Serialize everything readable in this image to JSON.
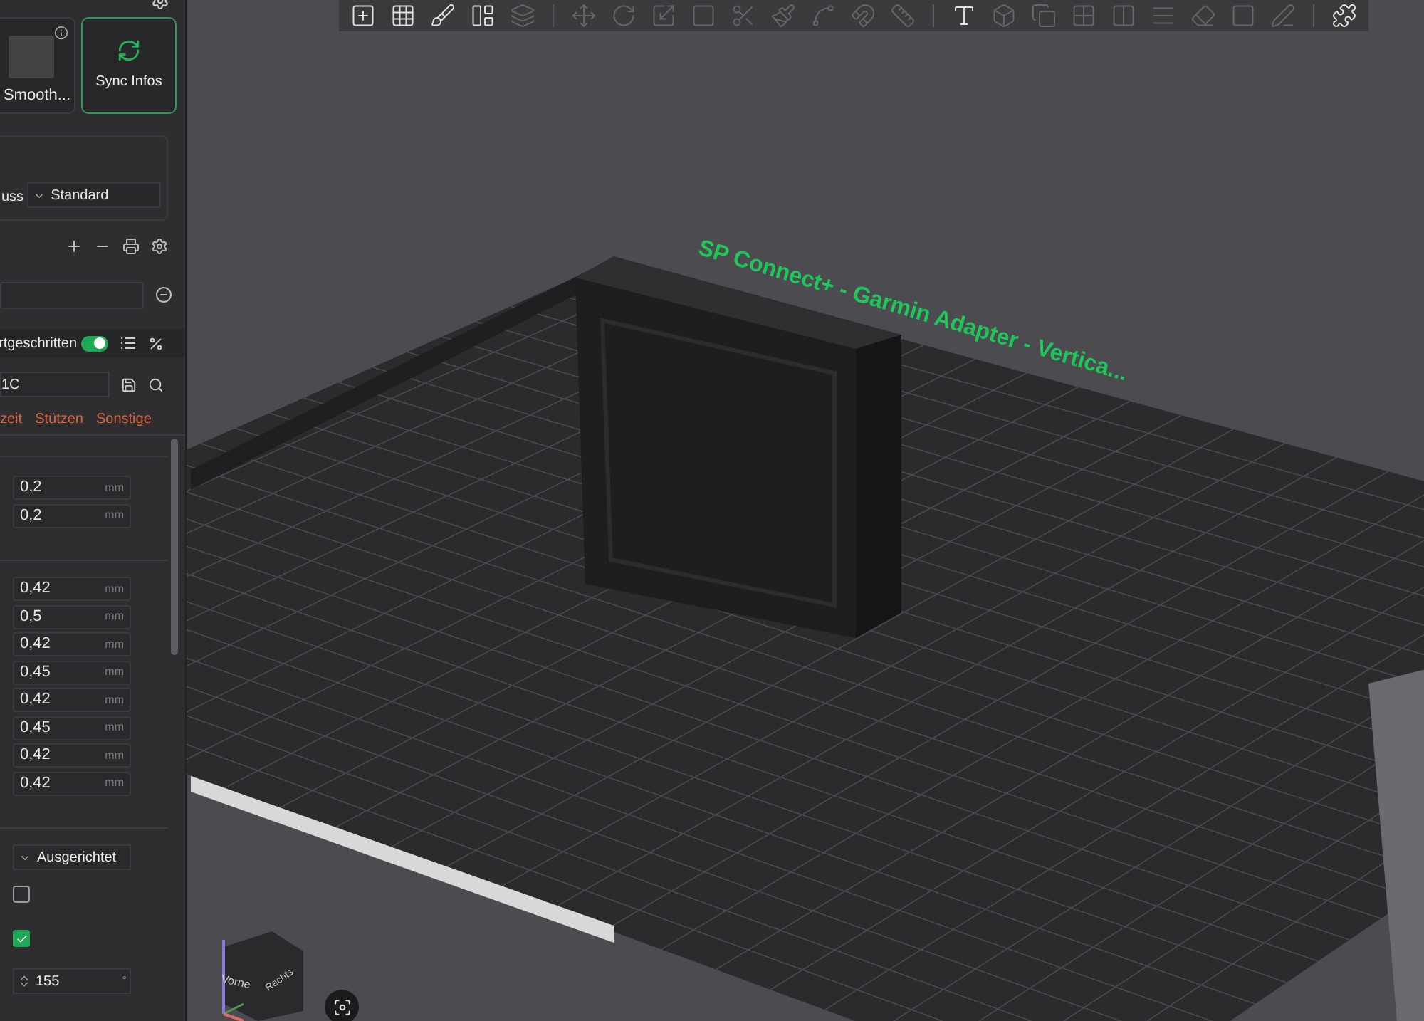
{
  "sidebar": {
    "plate_card": {
      "label": "Smooth..."
    },
    "sync_card": {
      "label": "Sync Infos"
    },
    "plate_type": {
      "label": "uss",
      "value": "Standard"
    },
    "mode_row": {
      "label": "rtgeschritten",
      "on": true
    },
    "preset_field": {
      "value": "1C"
    },
    "tabs": [
      {
        "label": "zeit"
      },
      {
        "label": "Stützen"
      },
      {
        "label": "Sonstige"
      }
    ],
    "groups": [
      {
        "fields": [
          {
            "value": "0,2",
            "unit": "mm"
          },
          {
            "value": "0,2",
            "unit": "mm"
          }
        ]
      },
      {
        "fields": [
          {
            "value": "0,42",
            "unit": "mm"
          },
          {
            "value": "0,5",
            "unit": "mm"
          },
          {
            "value": "0,42",
            "unit": "mm"
          },
          {
            "value": "0,45",
            "unit": "mm"
          },
          {
            "value": "0,42",
            "unit": "mm"
          },
          {
            "value": "0,45",
            "unit": "mm"
          },
          {
            "value": "0,42",
            "unit": "mm"
          },
          {
            "value": "0,42",
            "unit": "mm"
          }
        ]
      }
    ],
    "pattern_dropdown": {
      "value": "Ausgerichtet"
    },
    "checkboxes": [
      {
        "checked": false
      },
      {
        "checked": true
      }
    ],
    "angle_field": {
      "value": "155",
      "unit": "°"
    }
  },
  "toolbar": {
    "groups": [
      [
        {
          "disabled": false
        },
        {
          "disabled": false
        },
        {
          "disabled": false
        },
        {
          "disabled": false
        },
        {
          "disabled": true
        }
      ],
      [
        {
          "disabled": true
        },
        {
          "disabled": true
        },
        {
          "disabled": true
        },
        {
          "disabled": true
        },
        {
          "disabled": true
        },
        {
          "disabled": true
        },
        {
          "disabled": true
        },
        {
          "disabled": true
        },
        {
          "disabled": true
        }
      ],
      [
        {
          "disabled": false
        },
        {
          "disabled": true
        },
        {
          "disabled": true
        },
        {
          "disabled": true
        },
        {
          "disabled": true
        },
        {
          "disabled": true
        },
        {
          "disabled": true
        },
        {
          "disabled": true
        },
        {
          "disabled": true
        }
      ],
      [
        {
          "disabled": false
        }
      ]
    ]
  },
  "viewport": {
    "plate_name": "SP Connect+ - Garmin Adapter - Vertica...",
    "view_cube": {
      "front": "Vorne",
      "right": "Rechts"
    }
  }
}
